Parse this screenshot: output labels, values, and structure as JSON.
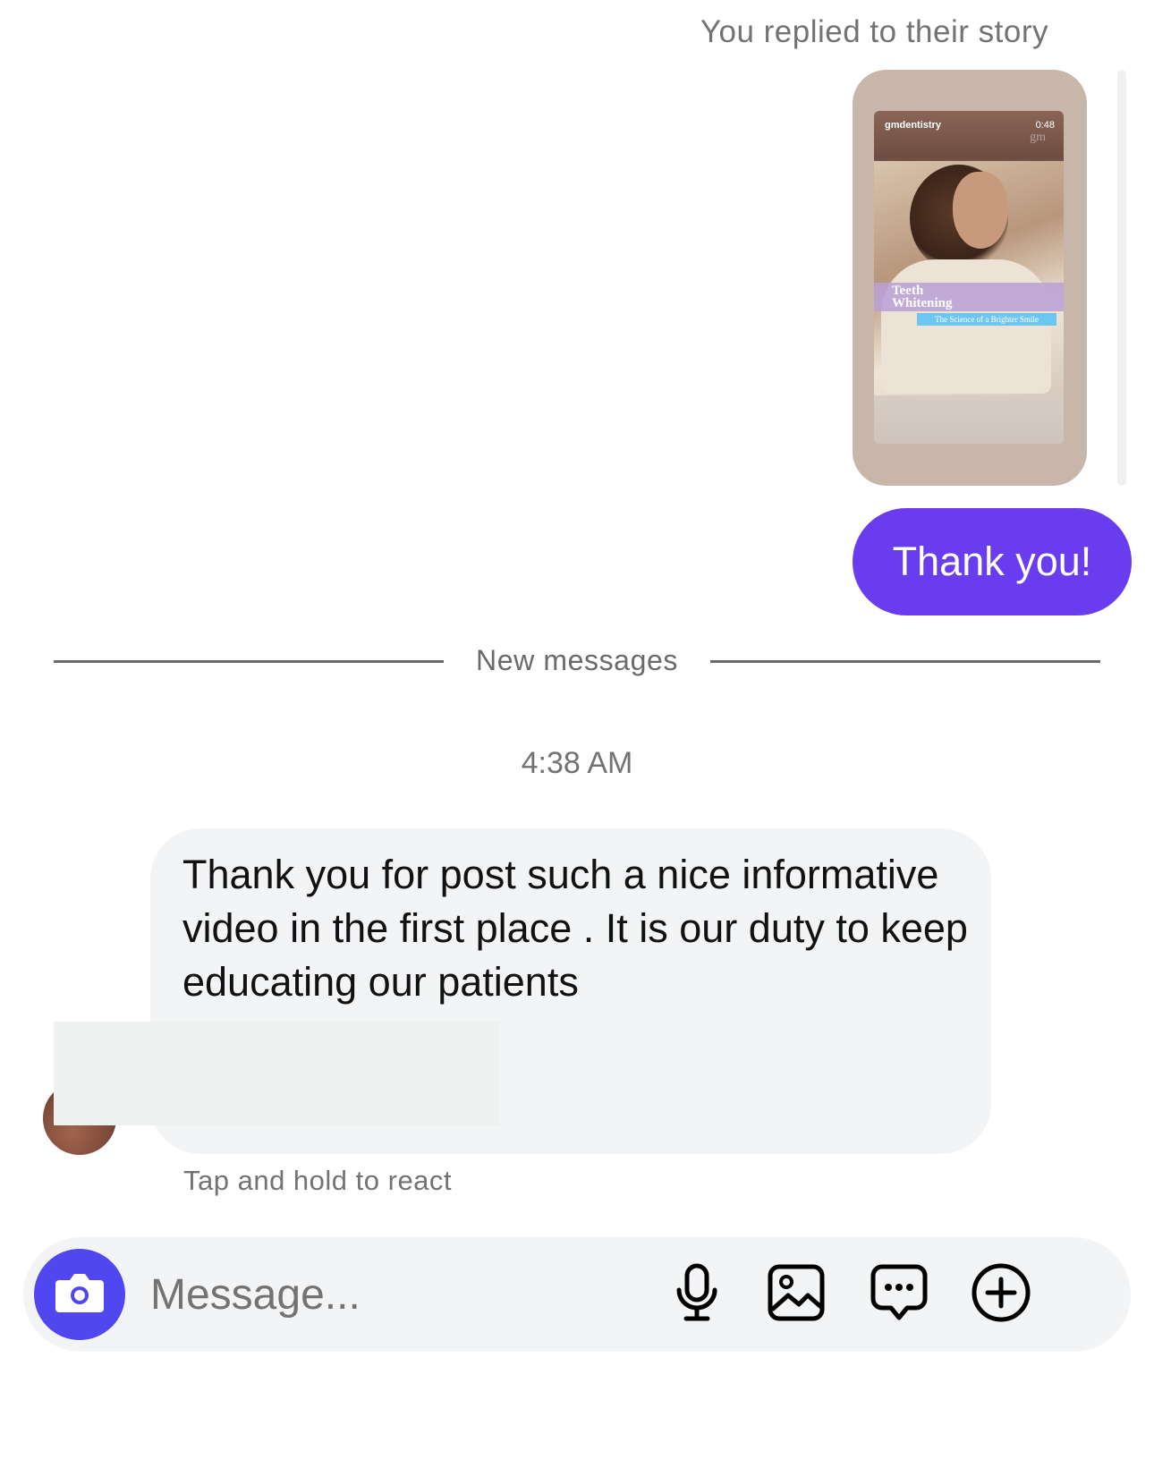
{
  "story": {
    "caption": "You replied to their story",
    "handle": "gmdentistry",
    "duration": "0:48",
    "watermark": "gm",
    "title_line1": "Teeth",
    "title_line2": "Whitening",
    "subtitle": "The Science of a Brighter Smile"
  },
  "outgoing": {
    "text": "Thank you!",
    "color": "#6a3cf0"
  },
  "separator": {
    "label": "New messages"
  },
  "timestamp": "4:38 AM",
  "incoming": {
    "text": "Thank you for post such a nice informative video in the first place . It is our duty to keep educating our patients"
  },
  "hint": "Tap and hold to react",
  "composer": {
    "placeholder": "Message...",
    "camera_color": "#5147f0",
    "icons": [
      "camera-icon",
      "microphone-icon",
      "image-icon",
      "sticker-chat-icon",
      "plus-circle-icon"
    ]
  }
}
